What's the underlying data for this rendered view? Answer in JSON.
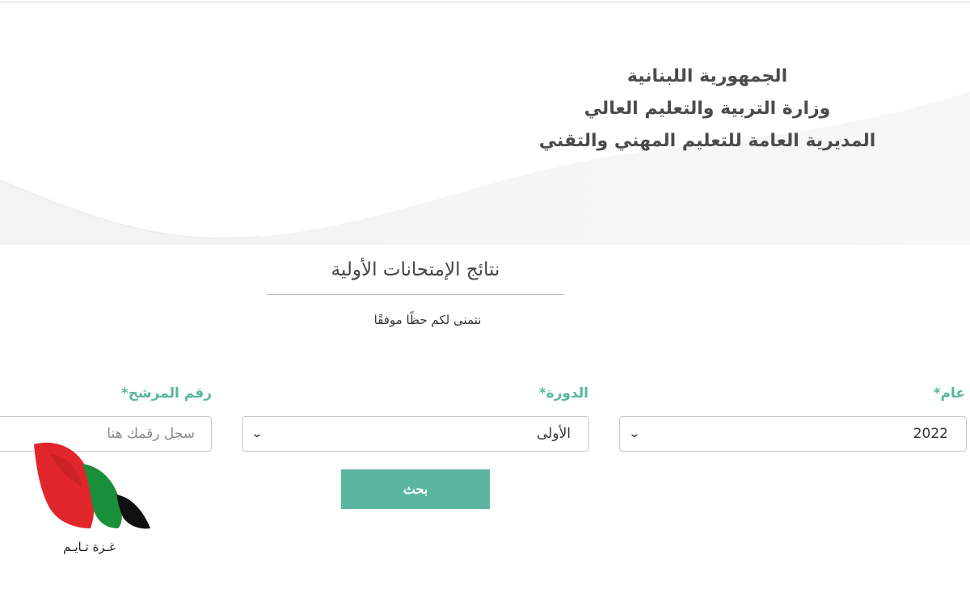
{
  "header": {
    "line1": "الجمهورية اللبنانية",
    "line2": "وزارة التربية والتعليم العالي",
    "line3": "المديرية العامة للتعليم المهني والتقني"
  },
  "page": {
    "title": "نتائج الإمتحانات الأولية",
    "subtitle": "نتمنى لكم حظًا موفقًا"
  },
  "form": {
    "year": {
      "label": "عام",
      "required": "*",
      "value": "2022"
    },
    "session": {
      "label": "الدورة",
      "required": "*",
      "value": "الأولى"
    },
    "candidate": {
      "label": "رقم المرشح",
      "required": "*",
      "placeholder": "سجل رقمك هنا"
    },
    "search_label": "بحث"
  },
  "watermark": {
    "text": "غـزة تـايـم",
    "colors": {
      "red": "#e0262b",
      "green": "#1a8f3a",
      "black": "#111111"
    }
  },
  "accent_color": "#5bb6a1",
  "icons": {
    "select_chevron": "chevron-down-icon"
  }
}
